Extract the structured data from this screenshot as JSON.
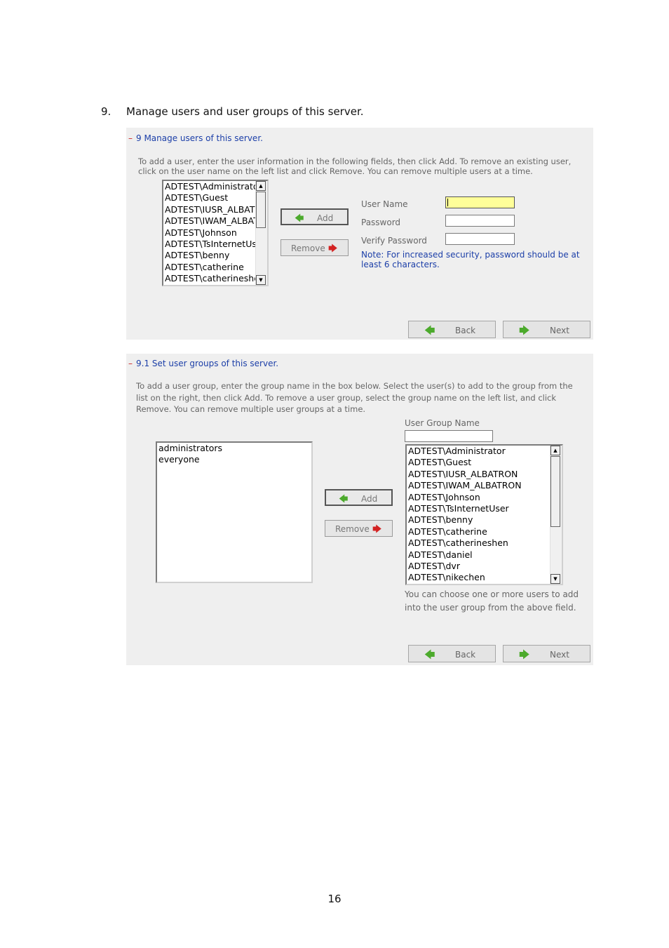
{
  "step": {
    "number": "9.",
    "text": "Manage users and user groups of this server."
  },
  "panel_users": {
    "title_prefix": "–",
    "title": "9 Manage users of this server.",
    "description_line1": "To add a user, enter the user information in the following fields, then click Add. To remove an existing user,",
    "description_line2": "click on the user name on the left list and click Remove. You can remove multiple users at a time.",
    "user_list": [
      "ADTEST\\Administrator",
      "ADTEST\\Guest",
      "ADTEST\\IUSR_ALBATRON",
      "ADTEST\\IWAM_ALBATRON",
      "ADTEST\\Johnson",
      "ADTEST\\TsInternetUser",
      "ADTEST\\benny",
      "ADTEST\\catherine",
      "ADTEST\\catherineshen"
    ],
    "add_label": "Add",
    "remove_label": "Remove",
    "user_name_label": "User Name",
    "password_label": "Password",
    "verify_password_label": "Verify Password",
    "user_name_value": "",
    "password_value": "",
    "verify_password_value": "",
    "note_line1": "Note: For increased security, password should be at",
    "note_line2": "least 6 characters.",
    "back_label": "Back",
    "next_label": "Next"
  },
  "panel_groups": {
    "title_prefix": "–",
    "title": "9.1 Set user groups of this server.",
    "description_line1": "To add a user group, enter the group name in the box below. Select the user(s) to add to the group from the",
    "description_line2": "list on the right, then click Add. To remove a user group, select the group name on the left list, and click",
    "description_line3": "Remove. You can remove multiple user groups at a time.",
    "group_name_label": "User Group Name",
    "group_name_value": "",
    "group_list": [
      "administrators",
      "everyone"
    ],
    "add_label": "Add",
    "remove_label": "Remove",
    "user_list": [
      "ADTEST\\Administrator",
      "ADTEST\\Guest",
      "ADTEST\\IUSR_ALBATRON",
      "ADTEST\\IWAM_ALBATRON",
      "ADTEST\\Johnson",
      "ADTEST\\TsInternetUser",
      "ADTEST\\benny",
      "ADTEST\\catherine",
      "ADTEST\\catherineshen",
      "ADTEST\\daniel",
      "ADTEST\\dvr",
      "ADTEST\\nikechen"
    ],
    "hint_line1": "You can choose one or more users to add",
    "hint_line2": "into the user group from the above field.",
    "back_label": "Back",
    "next_label": "Next"
  },
  "icons": {
    "left_arrow": "left-arrow-icon",
    "right_arrow": "right-arrow-icon",
    "scroll_up": "scroll-up-icon",
    "scroll_down": "scroll-down-icon"
  },
  "colors": {
    "panel_bg": "#efefef",
    "title_blue": "#1c3fa8",
    "input_highlight": "#ffff99",
    "arrow_green": "#4caa2c",
    "arrow_red": "#d32222"
  },
  "page_number": "16"
}
